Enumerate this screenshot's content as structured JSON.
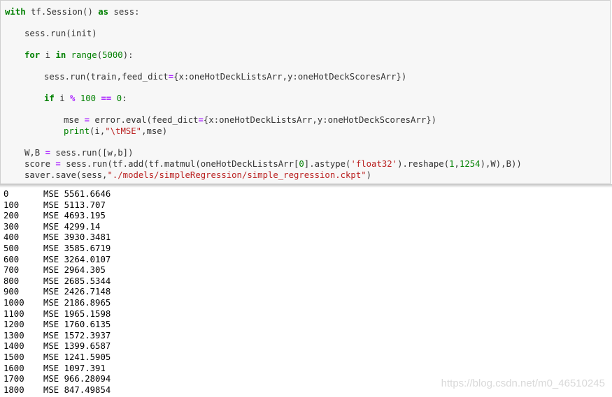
{
  "code": {
    "with_kw": "with",
    "session_call": " tf.Session() ",
    "as_kw": "as",
    "sess_name": " sess:",
    "run_init": "sess.run(init)",
    "for_kw": "for",
    "loop_var": " i ",
    "in_kw": "in",
    "range_fn": "range",
    "range_num": "5000",
    "train_line_a": "sess.run(train,feed_dict",
    "train_line_b": "{x:oneHotDeckListsArr,y:oneHotDeckScoresArr})",
    "if_kw": "if",
    "if_var": " i ",
    "mod_op": "%",
    "hundred": "100",
    "eq_op": "==",
    "zero": "0",
    "mse_var": "mse ",
    "mse_rest_a": " error.eval(feed_dict",
    "mse_rest_b": "{x:oneHotDeckListsArr,y:oneHotDeckScoresArr})",
    "print_fn": "print",
    "print_args_a": "(i,",
    "print_str": "\"\\tMSE\"",
    "print_args_b": ",mse)",
    "wb_line": "W,B ",
    "wb_rest": " sess.run([w,b])",
    "score_a": "score ",
    "score_b": " sess.run(tf.add(tf.matmul(oneHotDeckListsArr[",
    "score_zero": "0",
    "score_c": "].astype(",
    "score_str": "'float32'",
    "score_d": ").reshape(",
    "score_one": "1",
    "score_e": ",",
    "score_dim": "1254",
    "score_f": "),W),B))",
    "saver_a": "saver.save(sess,",
    "saver_str": "\"./models/simpleRegression/simple_regression.ckpt\"",
    "saver_b": ")",
    "eq_sign": "=",
    "assign": "="
  },
  "output": [
    {
      "step": "0",
      "label": "MSE",
      "value": "5561.6646"
    },
    {
      "step": "100",
      "label": "MSE",
      "value": "5113.707"
    },
    {
      "step": "200",
      "label": "MSE",
      "value": "4693.195"
    },
    {
      "step": "300",
      "label": "MSE",
      "value": "4299.14"
    },
    {
      "step": "400",
      "label": "MSE",
      "value": "3930.3481"
    },
    {
      "step": "500",
      "label": "MSE",
      "value": "3585.6719"
    },
    {
      "step": "600",
      "label": "MSE",
      "value": "3264.0107"
    },
    {
      "step": "700",
      "label": "MSE",
      "value": "2964.305"
    },
    {
      "step": "800",
      "label": "MSE",
      "value": "2685.5344"
    },
    {
      "step": "900",
      "label": "MSE",
      "value": "2426.7148"
    },
    {
      "step": "1000",
      "label": "MSE",
      "value": "2186.8965"
    },
    {
      "step": "1100",
      "label": "MSE",
      "value": "1965.1598"
    },
    {
      "step": "1200",
      "label": "MSE",
      "value": "1760.6135"
    },
    {
      "step": "1300",
      "label": "MSE",
      "value": "1572.3937"
    },
    {
      "step": "1400",
      "label": "MSE",
      "value": "1399.6587"
    },
    {
      "step": "1500",
      "label": "MSE",
      "value": "1241.5905"
    },
    {
      "step": "1600",
      "label": "MSE",
      "value": "1097.391"
    },
    {
      "step": "1700",
      "label": "MSE",
      "value": "966.28094"
    },
    {
      "step": "1800",
      "label": "MSE",
      "value": "847.49854"
    }
  ],
  "watermark": "https://blog.csdn.net/m0_46510245"
}
